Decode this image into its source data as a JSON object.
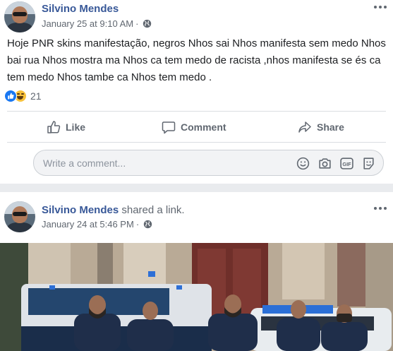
{
  "post1": {
    "author": "Silvino Mendes",
    "timestamp": "January 25 at 9:10 AM",
    "text": "Hoje PNR skins manifestação, negros Nhos sai Nhos manifesta sem medo Nhos bai rua Nhos mostra ma Nhos ca tem medo de racista ,nhos manifesta se és ca tem medo Nhos tambe ca Nhos tem medo .",
    "reaction_count": "21",
    "reactions": [
      "like",
      "haha"
    ],
    "actions": {
      "like": "Like",
      "comment": "Comment",
      "share": "Share"
    },
    "comment_placeholder": "Write a comment...",
    "comment_icons": [
      "emoji-icon",
      "camera-icon",
      "gif-icon",
      "sticker-icon"
    ]
  },
  "post2": {
    "author": "Silvino Mendes",
    "shared_text": "shared a link.",
    "timestamp": "January 24 at 5:46 PM"
  },
  "colors": {
    "name": "#385898",
    "meta": "#606770",
    "like_blue": "#1877f2",
    "haha_yellow": "#f7c13b",
    "background": "#e9ebee"
  }
}
